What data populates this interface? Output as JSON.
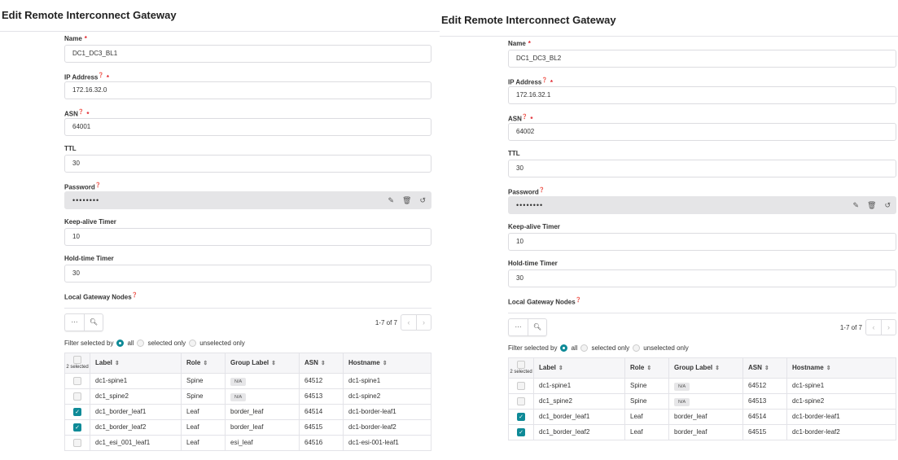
{
  "common": {
    "title": "Edit Remote Interconnect Gateway",
    "fields": {
      "name": "Name",
      "ip": "IP Address",
      "asn": "ASN",
      "ttl": "TTL",
      "password": "Password",
      "keepalive": "Keep-alive Timer",
      "holdtime": "Hold-time Timer"
    },
    "required_mark": "*",
    "help_icon": "?",
    "section": "Local Gateway Nodes",
    "more_label": "···",
    "pager": "1-7 of 7",
    "filter_label": "Filter selected by",
    "filter_options": [
      "all",
      "selected only",
      "unselected only"
    ],
    "selected_count": "2 selected",
    "columns": [
      "Label",
      "Role",
      "Group Label",
      "ASN",
      "Hostname"
    ],
    "accent": "#0e8a97"
  },
  "panels": [
    {
      "name": "DC1_DC3_BL1",
      "ip": "172.16.32.0",
      "asn": "64001",
      "ttl": "30",
      "password": "••••••••",
      "keepalive": "10",
      "holdtime": "30",
      "rows": [
        {
          "checked": false,
          "label": "dc1-spine1",
          "role": "Spine",
          "group": "N/A",
          "group_badge": true,
          "asn": "64512",
          "hostname": "dc1-spine1"
        },
        {
          "checked": false,
          "label": "dc1_spine2",
          "role": "Spine",
          "group": "N/A",
          "group_badge": true,
          "asn": "64513",
          "hostname": "dc1-spine2"
        },
        {
          "checked": true,
          "label": "dc1_border_leaf1",
          "role": "Leaf",
          "group": "border_leaf",
          "group_badge": false,
          "asn": "64514",
          "hostname": "dc1-border-leaf1"
        },
        {
          "checked": true,
          "label": "dc1_border_leaf2",
          "role": "Leaf",
          "group": "border_leaf",
          "group_badge": false,
          "asn": "64515",
          "hostname": "dc1-border-leaf2"
        },
        {
          "checked": false,
          "label": "dc1_esi_001_leaf1",
          "role": "Leaf",
          "group": "esi_leaf",
          "group_badge": false,
          "asn": "64516",
          "hostname": "dc1-esi-001-leaf1"
        }
      ]
    },
    {
      "name": "DC1_DC3_BL2",
      "ip": "172.16.32.1",
      "asn": "64002",
      "ttl": "30",
      "password": "••••••••",
      "keepalive": "10",
      "holdtime": "30",
      "rows": [
        {
          "checked": false,
          "label": "dc1-spine1",
          "role": "Spine",
          "group": "N/A",
          "group_badge": true,
          "asn": "64512",
          "hostname": "dc1-spine1"
        },
        {
          "checked": false,
          "label": "dc1_spine2",
          "role": "Spine",
          "group": "N/A",
          "group_badge": true,
          "asn": "64513",
          "hostname": "dc1-spine2"
        },
        {
          "checked": true,
          "label": "dc1_border_leaf1",
          "role": "Leaf",
          "group": "border_leaf",
          "group_badge": false,
          "asn": "64514",
          "hostname": "dc1-border-leaf1"
        },
        {
          "checked": true,
          "label": "dc1_border_leaf2",
          "role": "Leaf",
          "group": "border_leaf",
          "group_badge": false,
          "asn": "64515",
          "hostname": "dc1-border-leaf2"
        }
      ]
    }
  ]
}
